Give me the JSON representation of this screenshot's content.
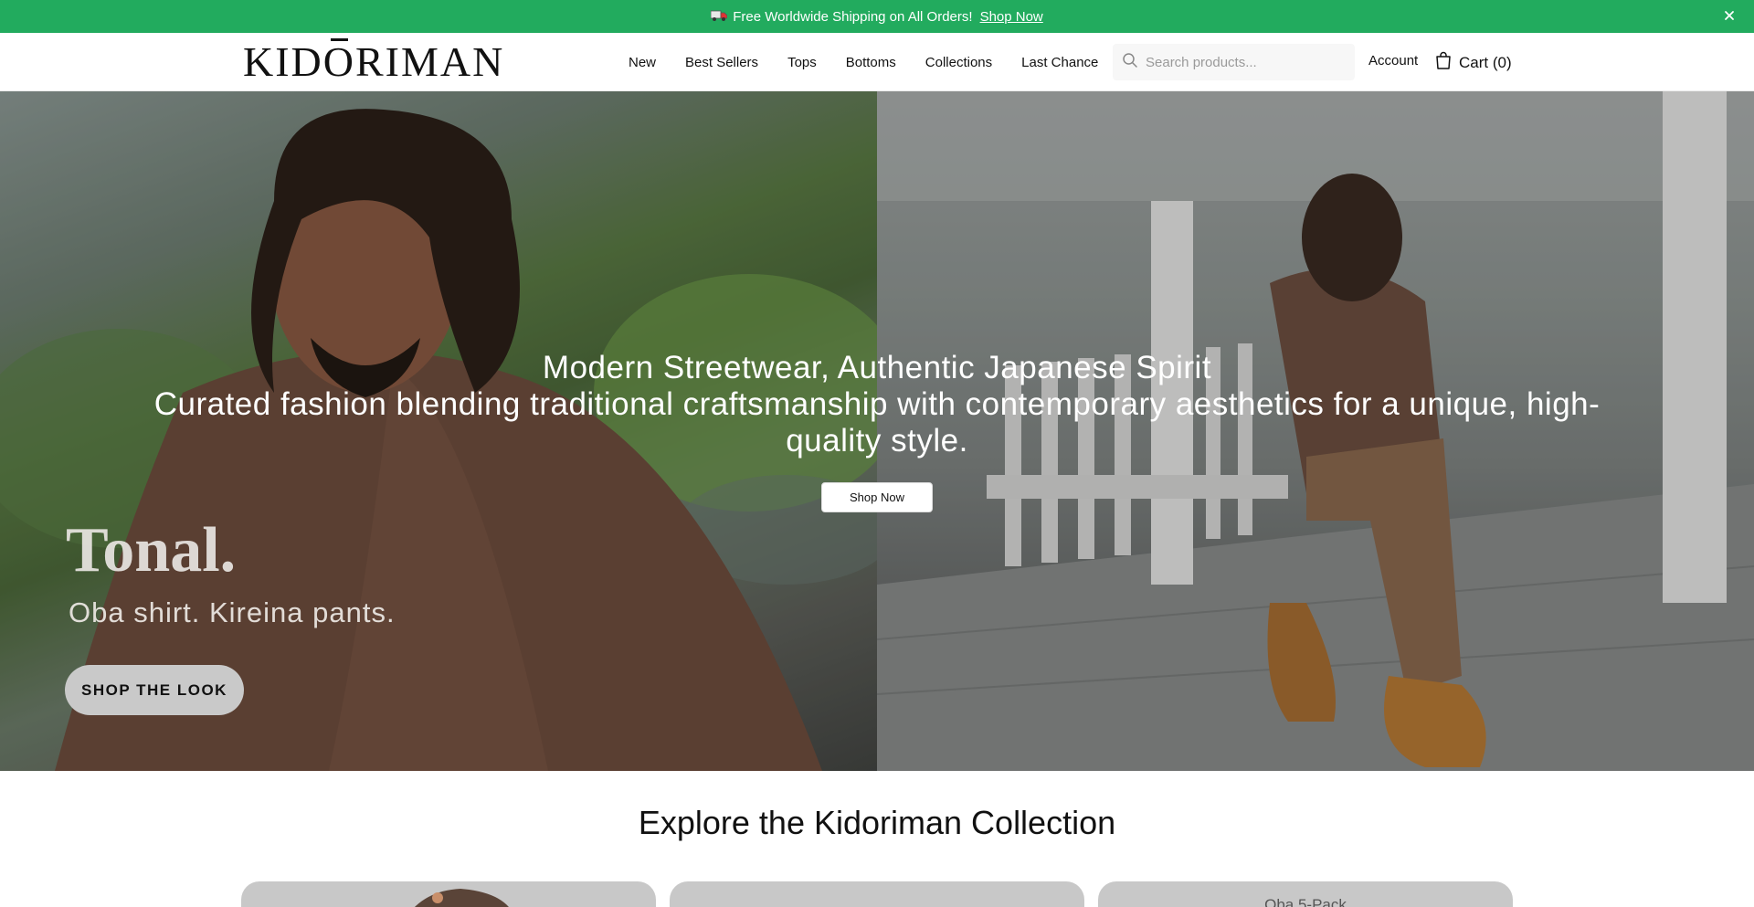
{
  "announcement": {
    "text": "Free Worldwide Shipping on All Orders!",
    "link": "Shop Now",
    "truck_icon": "truck-icon",
    "close_icon": "close-icon",
    "background": "#22ab5e"
  },
  "header": {
    "logo": "KIDORIMAN",
    "nav": [
      "New",
      "Best Sellers",
      "Tops",
      "Bottoms",
      "Collections",
      "Last Chance"
    ],
    "search_placeholder": "Search products...",
    "search_icon": "search-icon",
    "account": "Account",
    "cart": "Cart (0)",
    "cart_icon": "shopping-bag-icon"
  },
  "hero": {
    "title": "Modern Streetwear, Authentic Japanese Spirit",
    "subtitle": "Curated fashion blending traditional craftsmanship with contemporary aesthetics for a unique, high-quality style.",
    "button": "Shop Now",
    "overlay_heading": "Tonal.",
    "overlay_sub": "Oba shirt. Kireina pants.",
    "overlay_button": "SHOP THE LOOK"
  },
  "collection": {
    "title": "Explore the Kidoriman Collection",
    "cards": [
      "",
      "",
      "Oba 5-Pack"
    ]
  }
}
